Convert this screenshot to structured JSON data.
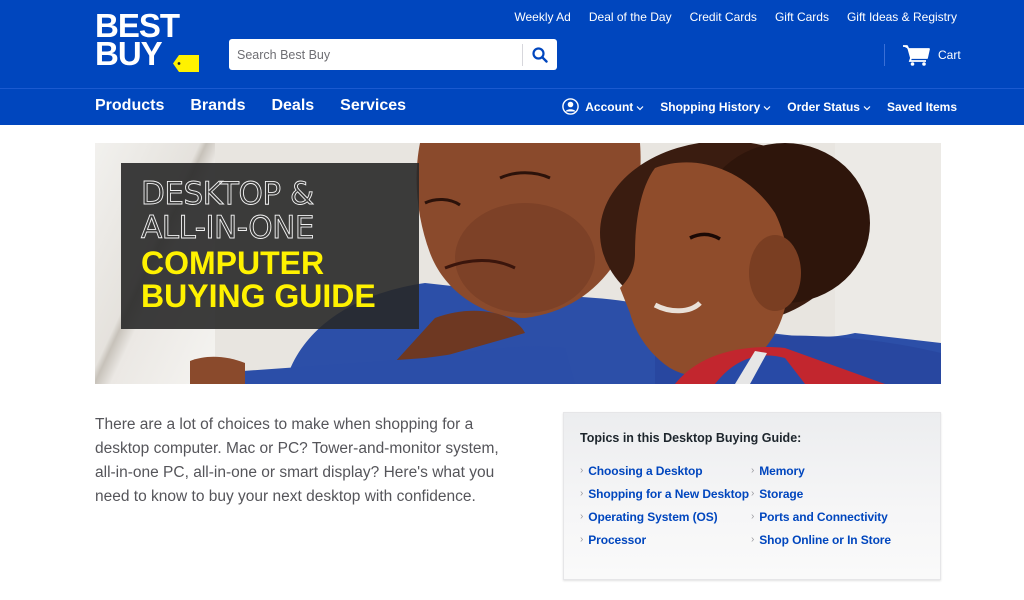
{
  "brand": {
    "logo_line1": "BEST",
    "logo_line2": "BUY",
    "tag_color": "#fff200",
    "header_color": "#0046be"
  },
  "search": {
    "placeholder": "Search Best Buy",
    "value": "",
    "button_icon": "search-icon"
  },
  "utility_nav": [
    {
      "label": "Weekly Ad"
    },
    {
      "label": "Deal of the Day"
    },
    {
      "label": "Credit Cards"
    },
    {
      "label": "Gift Cards"
    },
    {
      "label": "Gift Ideas & Registry"
    }
  ],
  "cart": {
    "label": "Cart",
    "icon": "cart-icon"
  },
  "main_nav": [
    {
      "label": "Products"
    },
    {
      "label": "Brands"
    },
    {
      "label": "Deals"
    },
    {
      "label": "Services"
    }
  ],
  "account_nav": [
    {
      "label": "Account",
      "icon": "user-icon",
      "has_dropdown": true
    },
    {
      "label": "Shopping History",
      "has_dropdown": true
    },
    {
      "label": "Order Status",
      "has_dropdown": true
    },
    {
      "label": "Saved Items",
      "has_dropdown": false
    }
  ],
  "hero": {
    "line1": "DESKTOP &",
    "line2": "ALL-IN-ONE",
    "line3": "COMPUTER",
    "line4": "BUYING GUIDE",
    "accent_color": "#fff200"
  },
  "intro": {
    "text": "There are a lot of choices to make when shopping for a desktop computer. Mac or PC? Tower-and-monitor system, all-in-one PC, all-in-one or smart display? Here's what you need to know to buy your next desktop with confidence."
  },
  "topics": {
    "title": "Topics in this Desktop Buying Guide:",
    "column1": [
      {
        "label": "Choosing a Desktop"
      },
      {
        "label": "Shopping for a New Desktop"
      },
      {
        "label": "Operating System (OS)"
      },
      {
        "label": "Processor"
      }
    ],
    "column2": [
      {
        "label": "Memory"
      },
      {
        "label": "Storage"
      },
      {
        "label": "Ports and Connectivity"
      },
      {
        "label": "Shop Online or In Store"
      }
    ],
    "chevron": "›",
    "link_color": "#0046be"
  },
  "chevron_down": "⌄"
}
